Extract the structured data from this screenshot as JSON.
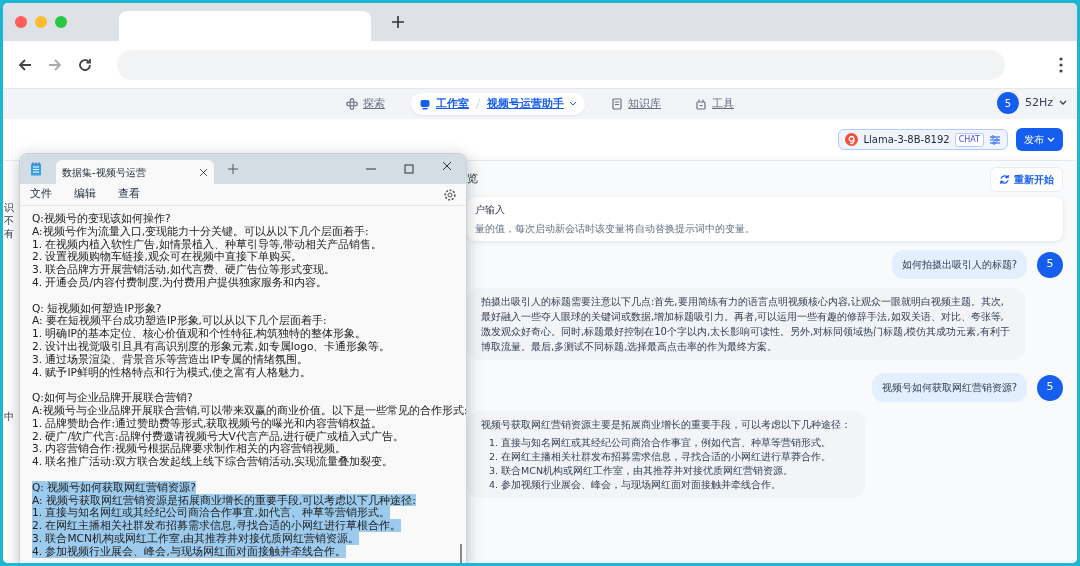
{
  "app_nav": {
    "items": [
      {
        "kind": "link",
        "label": "探索",
        "selected": false
      },
      {
        "kind": "crumb",
        "label": "工作室",
        "sub": "视频号运营助手",
        "selected": true
      },
      {
        "kind": "link",
        "label": "知识库",
        "selected": false
      },
      {
        "kind": "link",
        "label": "工具",
        "selected": false
      }
    ],
    "user": {
      "avatar": "5",
      "name": "52Hz"
    }
  },
  "toolbar": {
    "model": "Llama-3-8B-8192",
    "model_tag": "CHAT",
    "publish": "发布"
  },
  "left_panel": {
    "fragments": [
      "识",
      "不",
      "有"
    ],
    "lower_fragment": "中"
  },
  "chat": {
    "title": "览",
    "restart": "重新开始",
    "input_card": {
      "title": "户输入",
      "description": "量的值，每次启动新会话时该变量将自动替换提示词中的变量。"
    },
    "messages": [
      {
        "kind": "user",
        "avatar": "5",
        "text": "如何拍摄出吸引人的标题?"
      },
      {
        "kind": "assistant",
        "text": "拍摄出吸引人的标题需要注意以下几点:首先,要用简练有力的语言点明视频核心内容,让观众一眼就明白视频主题。其次,最好融入一些夺人眼球的关键词或数据,增加标题吸引力。再者,可以运用一些有趣的修辞手法,如双关语、对比、夸张等,激发观众好奇心。同时,标题最好控制在10个字以内,太长影响可读性。另外,对标同领域热门标题,模仿其成功元素,有利于博取流量。最后,多测试不同标题,选择最高点击率的作为最终方案。"
      },
      {
        "kind": "user",
        "avatar": "5",
        "text": "视频号如何获取网红营销资源?"
      },
      {
        "kind": "assistant",
        "text": "视频号获取网红营销资源主要是拓展商业增长的重要手段，可以考虑以下几种途径：",
        "list": [
          "1. 直接与知名网红或其经纪公司商洽合作事宜，例如代言、种草等营销形式。",
          "2. 在网红主播相关社群发布招募需求信息，寻找合适的小网红进行草莽合作。",
          "3. 联合MCN机构或网红工作室，由其推荐并对接优质网红营销资源。",
          "4. 参加视频行业展会、峰会，与现场网红面对面接触并牵线合作。"
        ]
      }
    ]
  },
  "notepad": {
    "tab_title": "数据集-视频号运营",
    "menu": [
      "文件",
      "编辑",
      "查看"
    ],
    "blocks": [
      {
        "selected": false,
        "lines": [
          "Q:视频号的变现该如何操作?",
          "A:视频号作为流量入口,变现能力十分关键。可以从以下几个层面着手:",
          "1. 在视频内植入软性广告,如情景植入、种草引导等,带动相关产品销售。",
          "2. 设置视频购物车链接,观众可在视频中直接下单购买。",
          "3. 联合品牌方开展营销活动,如代言费、硬广告位等形式变现。",
          "4. 开通会员/内容付费制度,为付费用户提供独家服务和内容。"
        ]
      },
      {
        "selected": false,
        "lines": [
          "Q: 短视频如何塑造IP形象?",
          "A: 要在短视频平台成功塑造IP形象,可以从以下几个层面着手:",
          "1. 明确IP的基本定位、核心价值观和个性特征,构筑独特的整体形象。",
          "2. 设计出视觉吸引且具有高识别度的形象元素,如专属logo、卡通形象等。",
          "3. 通过场景渲染、背景音乐等营造出IP专属的情绪氛围。",
          "4. 赋予IP鲜明的性格特点和行为模式,使之富有人格魅力。"
        ]
      },
      {
        "selected": false,
        "lines": [
          "Q:如何与企业品牌开展联合营销?",
          "A:视频号与企业品牌开展联合营销,可以带来双赢的商业价值。以下是一些常见的合作形式:",
          "1. 品牌赞助合作:通过赞助费等形式,获取视频号的曝光和内容营销权益。",
          "2. 硬广/软广代言:品牌付费邀请视频号大V代言产品,进行硬广或植入式广告。",
          "3. 内容营销合作:视频号根据品牌要求制作相关的内容营销视频。",
          "4. 联名推广活动:双方联合发起线上线下综合营销活动,实现流量叠加裂变。"
        ]
      },
      {
        "selected": true,
        "lines": [
          "Q: 视频号如何获取网红营销资源?",
          "A: 视频号获取网红营销资源是拓展商业增长的重要手段,可以考虑以下几种途径:",
          "1. 直接与知名网红或其经纪公司商洽合作事宜,如代言、种草等营销形式。",
          "2. 在网红主播相关社群发布招募需求信息,寻找合适的小网红进行草根合作。",
          "3. 联合MCN机构或网红工作室,由其推荐并对接优质网红营销资源。",
          "4. 参加视频行业展会、峰会,与现场网红面对面接触并牵线合作。"
        ]
      }
    ]
  }
}
